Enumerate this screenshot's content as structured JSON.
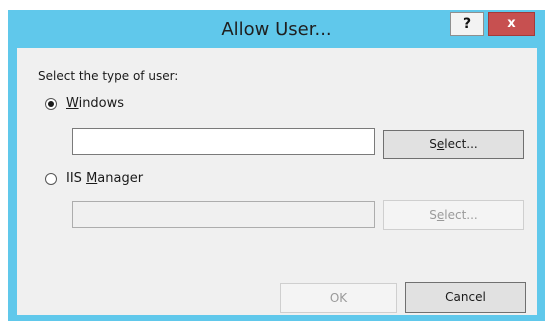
{
  "window": {
    "title": "Allow User...",
    "help_label": "?",
    "close_label": "x"
  },
  "form": {
    "prompt": "Select the type of user:",
    "windows_option": {
      "accel": "W",
      "rest": "indows",
      "selected": true,
      "input_value": "",
      "select_button": {
        "pre": "S",
        "accel": "e",
        "post": "lect..."
      }
    },
    "iis_option": {
      "pre": "IIS ",
      "accel": "M",
      "rest": "anager",
      "selected": false,
      "input_value": "",
      "select_button": {
        "pre": "S",
        "accel": "e",
        "post": "lect..."
      }
    }
  },
  "footer": {
    "ok_label": "OK",
    "cancel_label": "Cancel"
  },
  "colors": {
    "titlebar": "#60c8eb",
    "close_button": "#c75050",
    "client_bg": "#f0f0f0"
  }
}
